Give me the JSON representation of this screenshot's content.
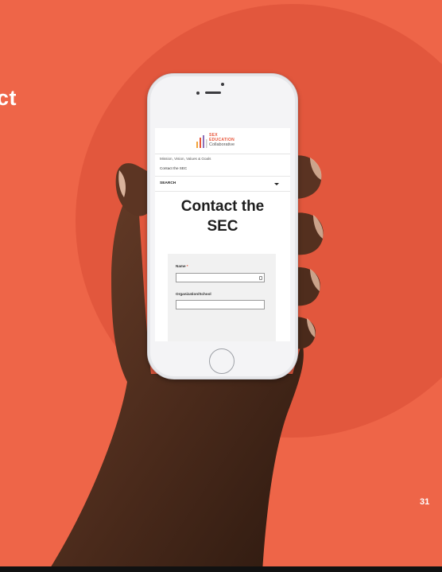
{
  "slide": {
    "heading_fragment": "ct",
    "page_number": "31"
  },
  "colors": {
    "background": "#ee6548",
    "circle": "#e2573d",
    "brand": "#e8553a"
  },
  "site": {
    "logo": {
      "line1": "SEX",
      "line2": "EDUCATION",
      "line3": "Collaborative"
    },
    "nav": [
      {
        "label": "Mission, Vision, Values & Goals"
      },
      {
        "label": "Contact the SEC"
      }
    ],
    "search": {
      "label": "SEARCH",
      "icon": "chevron-down-icon"
    },
    "page_title_line1": "Contact the",
    "page_title_line2": "SEC",
    "form": {
      "name_label": "Name",
      "name_required_mark": "*",
      "org_label": "Organization/School",
      "name_value": "",
      "org_value": ""
    }
  }
}
